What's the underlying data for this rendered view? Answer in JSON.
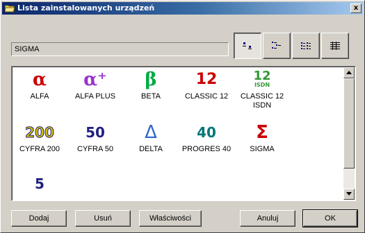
{
  "window": {
    "title": "Lista zainstalowanych urządzeń",
    "close_label": "x"
  },
  "path": {
    "value": "SIGMA"
  },
  "view_buttons": [
    {
      "icon": "large-icons-view-icon",
      "pressed": true
    },
    {
      "icon": "small-icons-view-icon",
      "pressed": false
    },
    {
      "icon": "list-view-icon",
      "pressed": false
    },
    {
      "icon": "details-view-icon",
      "pressed": false
    }
  ],
  "devices": [
    {
      "label": "ALFA",
      "glyph": "α",
      "color": "#cc0000"
    },
    {
      "label": "ALFA PLUS",
      "glyph": "α⁺",
      "color": "#9933cc"
    },
    {
      "label": "BETA",
      "glyph": "β",
      "color": "#00aa44"
    },
    {
      "label": "CLASSIC 12",
      "glyph": "12",
      "color": "#cc0000"
    },
    {
      "label": "CLASSIC 12 ISDN",
      "glyph": "12",
      "glyph_sub": "ISDN",
      "color": "#339933"
    },
    {
      "label": "CYFRA 200",
      "glyph": "200",
      "color": "#d4c000"
    },
    {
      "label": "CYFRA 50",
      "glyph": "50",
      "color": "#202080"
    },
    {
      "label": "DELTA",
      "glyph": "Δ",
      "color": "#3366cc"
    },
    {
      "label": "PROGRES 40",
      "glyph": "40",
      "color": "#007777"
    },
    {
      "label": "SIGMA",
      "glyph": "Σ",
      "color": "#cc0000"
    },
    {
      "label": "",
      "glyph": "5",
      "color": "#202080"
    }
  ],
  "buttons": {
    "add": "Dodaj",
    "remove": "Usuń",
    "properties": "Właściwości",
    "cancel": "Anuluj",
    "ok": "OK"
  }
}
